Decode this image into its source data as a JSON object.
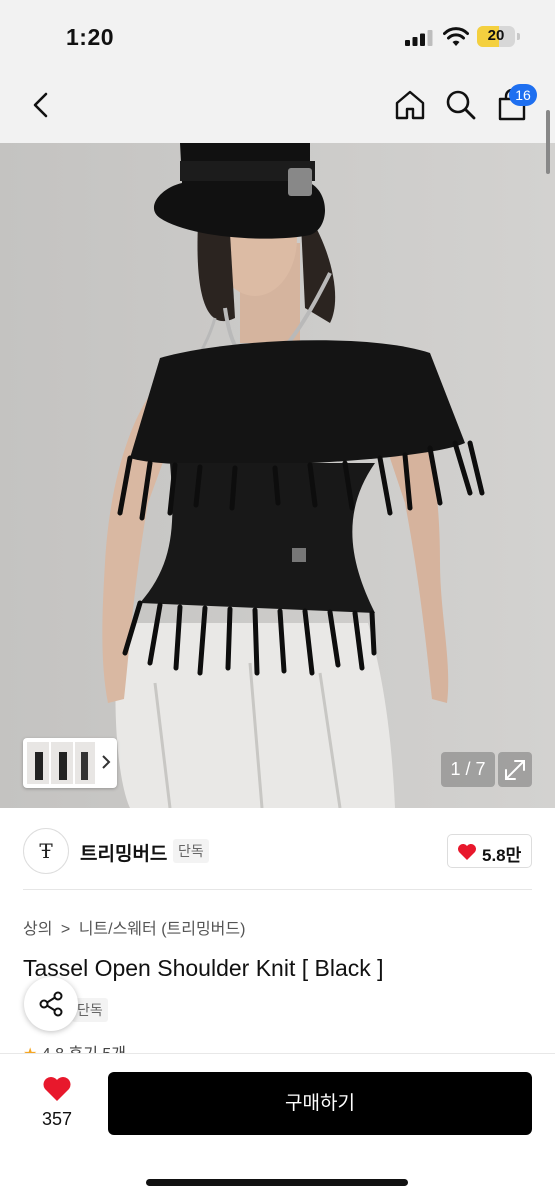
{
  "status_bar": {
    "time": "1:20",
    "battery": "20",
    "battery_level": 0.2
  },
  "nav": {
    "cart_count": "16"
  },
  "gallery": {
    "counter": "1 / 7"
  },
  "brand": {
    "logo_text": "Ŧ",
    "name": "트리밍버드",
    "tag": "단독",
    "likes": "5.8만"
  },
  "breadcrumb": {
    "category": "상의",
    "separator": ">",
    "subcategory": "니트/스웨터 (트리밍버드)"
  },
  "product": {
    "title": "Tassel Open Shoulder Knit [ Black ]",
    "tag": "단독",
    "rating": "4.8",
    "reviews": "후기 5개"
  },
  "bottom_bar": {
    "wish_count": "357",
    "buy_label": "구매하기"
  },
  "colors": {
    "accent": "#1e6ff0",
    "heart": "#e8182c",
    "primary_button": "#000000"
  }
}
